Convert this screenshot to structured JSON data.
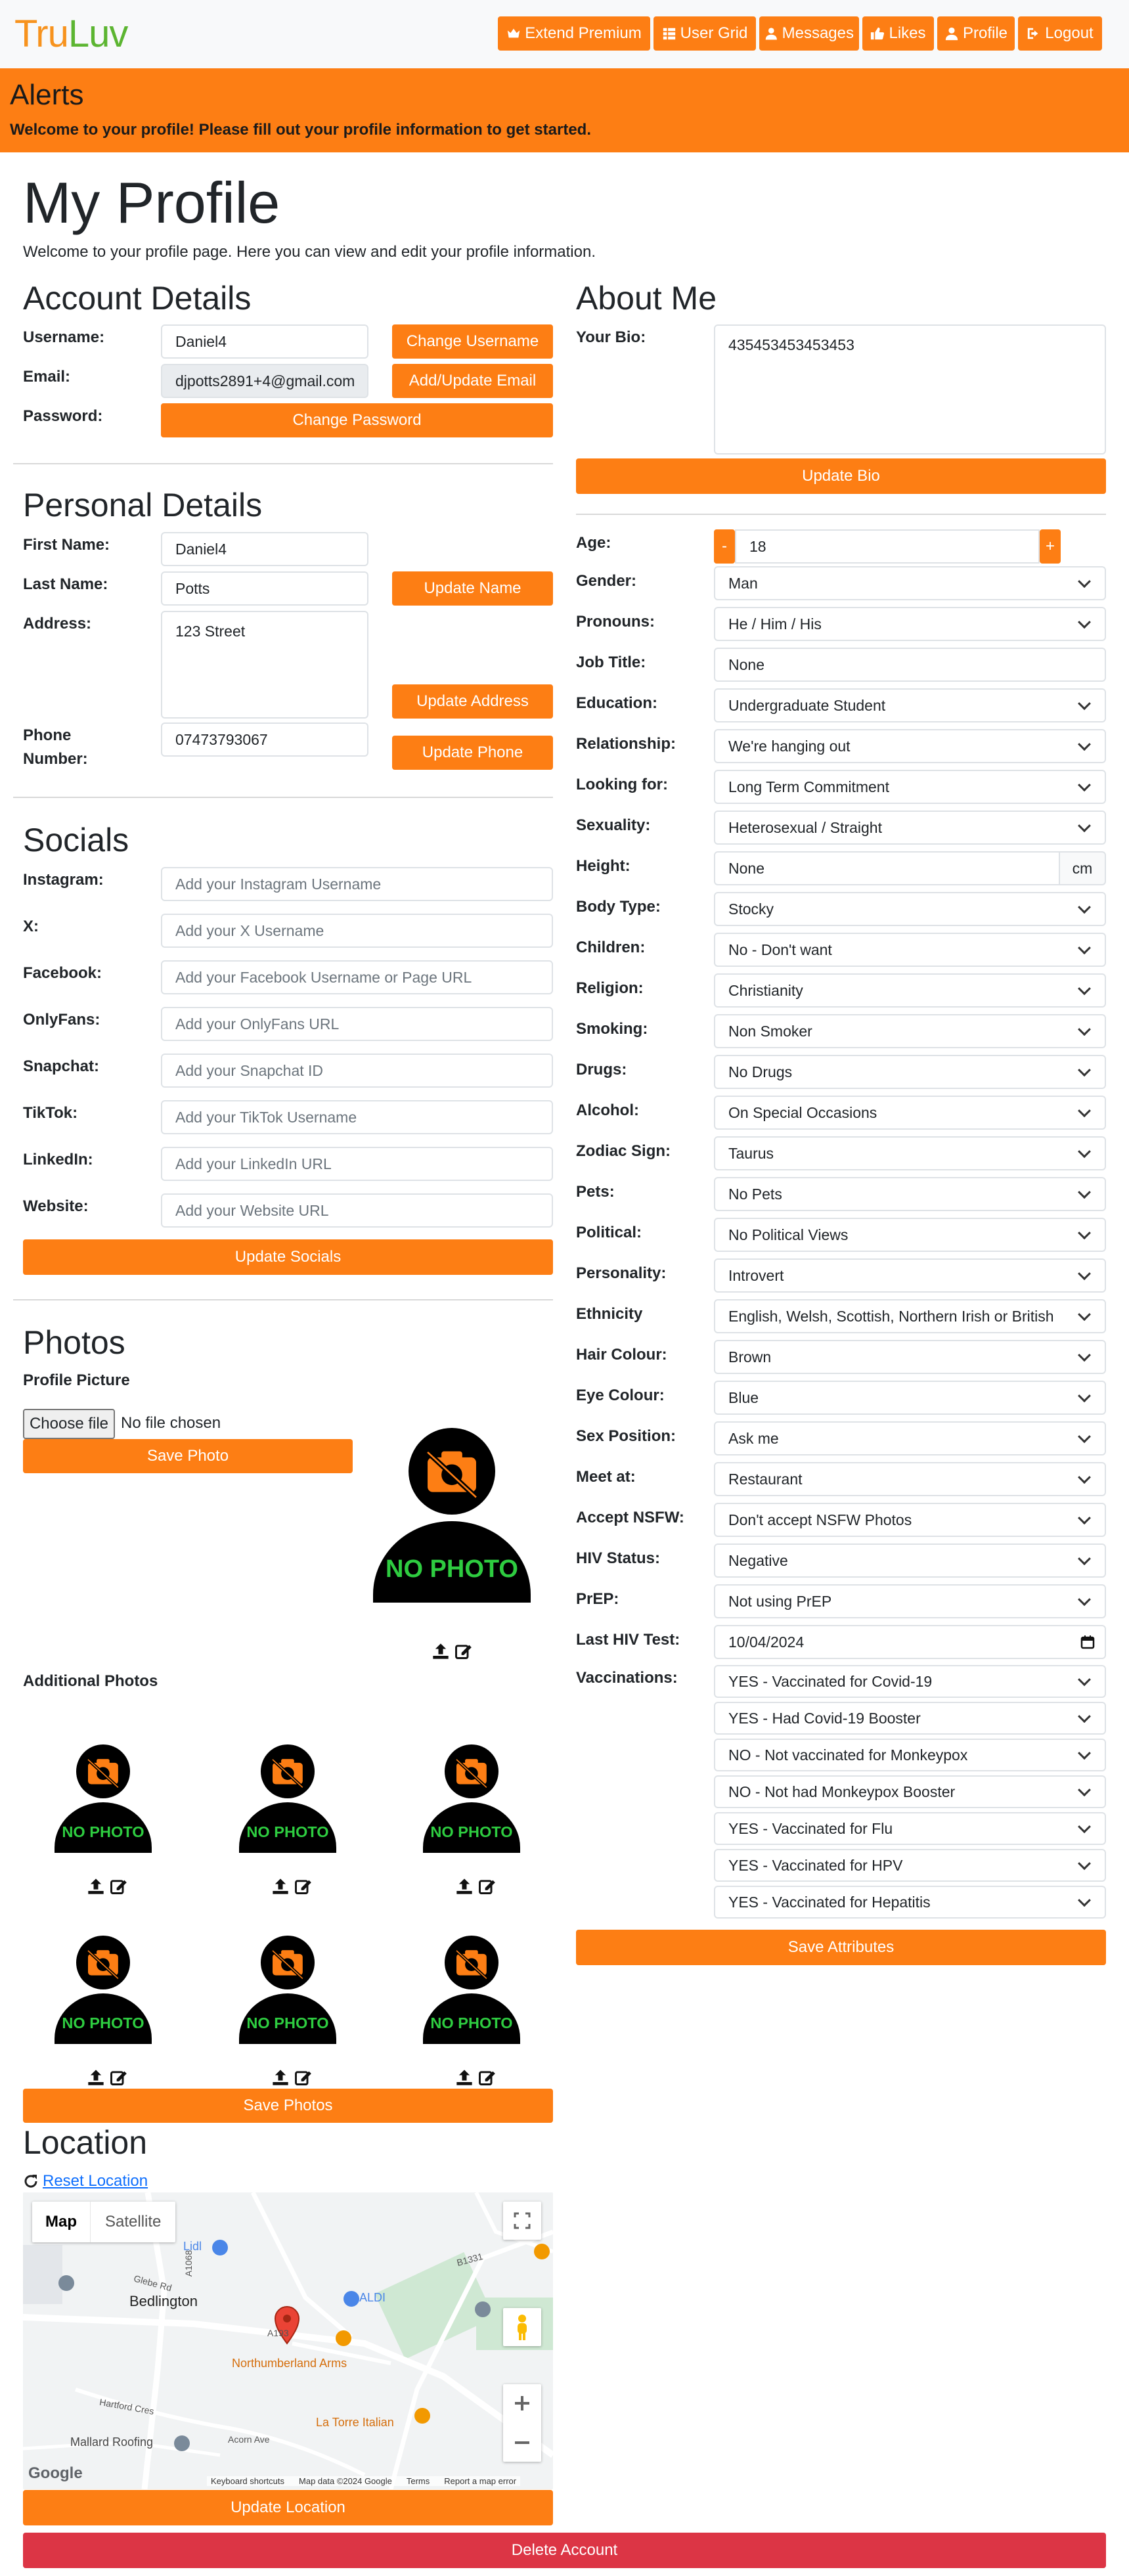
{
  "nav": {
    "logo_part1": "Tru",
    "logo_part2": "Luv",
    "extend_premium": "Extend Premium",
    "user_grid": "User Grid",
    "messages": "Messages",
    "likes": "Likes",
    "profile": "Profile",
    "logout": "Logout"
  },
  "alerts": {
    "title": "Alerts",
    "message": "Welcome to your profile! Please fill out your profile information to get started."
  },
  "page": {
    "title": "My Profile",
    "intro": "Welcome to your profile page. Here you can view and edit your profile information."
  },
  "account": {
    "heading": "Account Details",
    "username_label": "Username:",
    "username_value": "Daniel4",
    "change_username": "Change Username",
    "email_label": "Email:",
    "email_value": "djpotts2891+4@gmail.com",
    "update_email": "Add/Update Email",
    "password_label": "Password:",
    "change_password": "Change Password"
  },
  "personal": {
    "heading": "Personal Details",
    "first_name_label": "First Name:",
    "first_name_value": "Daniel4",
    "last_name_label": "Last Name:",
    "last_name_value": "Potts",
    "update_name": "Update Name",
    "address_label": "Address:",
    "address_value": "123 Street",
    "update_address": "Update Address",
    "phone_label_1": "Phone",
    "phone_label_2": "Number:",
    "phone_value": "07473793067",
    "update_phone": "Update Phone"
  },
  "socials": {
    "heading": "Socials",
    "items": [
      {
        "label": "Instagram:",
        "placeholder": "Add your Instagram Username"
      },
      {
        "label": "X:",
        "placeholder": "Add your X Username"
      },
      {
        "label": "Facebook:",
        "placeholder": "Add your Facebook Username or Page URL"
      },
      {
        "label": "OnlyFans:",
        "placeholder": "Add your OnlyFans URL"
      },
      {
        "label": "Snapchat:",
        "placeholder": "Add your Snapchat ID"
      },
      {
        "label": "TikTok:",
        "placeholder": "Add your TikTok Username"
      },
      {
        "label": "LinkedIn:",
        "placeholder": "Add your LinkedIn URL"
      },
      {
        "label": "Website:",
        "placeholder": "Add your Website URL"
      }
    ],
    "update": "Update Socials"
  },
  "photos": {
    "heading": "Photos",
    "profile_picture_label": "Profile Picture",
    "choose_file": "Choose file",
    "no_file": "No file chosen",
    "save_photo": "Save Photo",
    "no_photo": "NO PHOTO",
    "additional_label": "Additional Photos",
    "save_photos": "Save Photos"
  },
  "location": {
    "heading": "Location",
    "reset": "Reset Location",
    "map_tab": "Map",
    "satellite_tab": "Satellite",
    "update": "Update Location",
    "map_labels": {
      "bedlington": "Bedlington",
      "northumberland_arms": "Northumberland Arms",
      "la_torre": "La Torre Italian",
      "mallard_roofing": "Mallard Roofing",
      "aldi": "ALDI",
      "lidl": "Lidl",
      "a1068": "A1068",
      "a193": "A193",
      "b1331": "B1331",
      "glebe_rd": "Glebe Rd",
      "acorn_ave": "Acorn Ave",
      "hartford_cres": "Hartford Cres",
      "google": "Google",
      "keyboard_shortcuts": "Keyboard shortcuts",
      "map_data": "Map data ©2024 Google",
      "terms": "Terms",
      "report": "Report a map error"
    }
  },
  "delete_account": "Delete Account",
  "about": {
    "heading": "About Me",
    "bio_label": "Your Bio:",
    "bio_value": "435453453453453",
    "update_bio": "Update Bio"
  },
  "attributes": {
    "age_label": "Age:",
    "age_value": "18",
    "minus": "-",
    "plus": "+",
    "height_unit": "cm",
    "rows": [
      {
        "label": "Gender:",
        "value": "Man"
      },
      {
        "label": "Pronouns:",
        "value": "He / Him / His"
      },
      {
        "label": "Job Title:",
        "value": "None"
      },
      {
        "label": "Education:",
        "value": "Undergraduate Student"
      },
      {
        "label": "Relationship:",
        "value": "We're hanging out"
      },
      {
        "label": "Looking for:",
        "value": "Long Term Commitment"
      },
      {
        "label": "Sexuality:",
        "value": "Heterosexual / Straight"
      },
      {
        "label": "Height:",
        "value": "None"
      },
      {
        "label": "Body Type:",
        "value": "Stocky"
      },
      {
        "label": "Children:",
        "value": "No - Don't want"
      },
      {
        "label": "Religion:",
        "value": "Christianity"
      },
      {
        "label": "Smoking:",
        "value": "Non Smoker"
      },
      {
        "label": "Drugs:",
        "value": "No Drugs"
      },
      {
        "label": "Alcohol:",
        "value": "On Special Occasions"
      },
      {
        "label": "Zodiac Sign:",
        "value": "Taurus"
      },
      {
        "label": "Pets:",
        "value": "No Pets"
      },
      {
        "label": "Political:",
        "value": "No Political Views"
      },
      {
        "label": "Personality:",
        "value": "Introvert"
      },
      {
        "label": "Ethnicity",
        "value": "English, Welsh, Scottish, Northern Irish or British"
      },
      {
        "label": "Hair Colour:",
        "value": "Brown"
      },
      {
        "label": "Eye Colour:",
        "value": "Blue"
      },
      {
        "label": "Sex Position:",
        "value": "Ask me"
      },
      {
        "label": "Meet at:",
        "value": "Restaurant"
      },
      {
        "label": "Accept NSFW:",
        "value": "Don't accept NSFW Photos"
      },
      {
        "label": "HIV Status:",
        "value": "Negative"
      },
      {
        "label": "PrEP:",
        "value": "Not using PrEP"
      },
      {
        "label": "Last HIV Test:",
        "value": "10/04/2024"
      }
    ],
    "vaccinations_label": "Vaccinations:",
    "vaccinations": [
      "YES - Vaccinated for Covid-19",
      "YES - Had Covid-19 Booster",
      "NO - Not vaccinated for Monkeypox",
      "NO - Not had Monkeypox Booster",
      "YES - Vaccinated for Flu",
      "YES - Vaccinated for HPV",
      "YES - Vaccinated for Hepatitis"
    ],
    "save": "Save Attributes"
  },
  "colors": {
    "accent": "#fd7e14",
    "danger": "#dc3545",
    "logo_orange": "#f7931e",
    "logo_green": "#5cb531",
    "no_photo_green": "#2ecc40"
  }
}
